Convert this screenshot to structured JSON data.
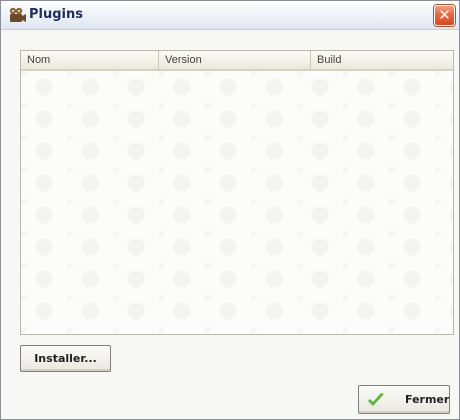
{
  "window": {
    "title": "Plugins",
    "icon": "film-camera-icon",
    "close_glyph": "✕"
  },
  "table": {
    "columns": [
      "Nom",
      "Version",
      "Build"
    ],
    "rows": []
  },
  "buttons": {
    "install_label": "Installer...",
    "close_label": "Fermer",
    "close_icon": "checkmark-icon"
  },
  "colors": {
    "title_text": "#1f2f63",
    "close_button": "#e6683f",
    "checkmark": "#5bb83a"
  }
}
